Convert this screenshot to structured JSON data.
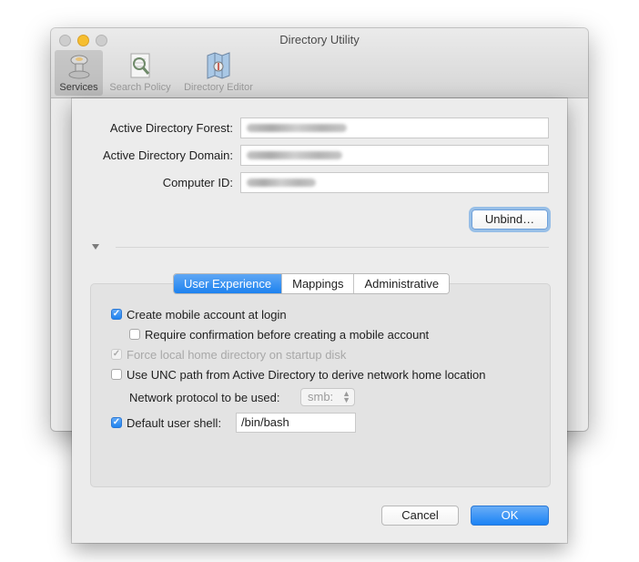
{
  "window": {
    "title": "Directory Utility",
    "toolbar": [
      {
        "label": "Services",
        "icon": "services-icon",
        "selected": true
      },
      {
        "label": "Search Policy",
        "icon": "search-policy-icon",
        "selected": false
      },
      {
        "label": "Directory Editor",
        "icon": "directory-editor-icon",
        "selected": false
      }
    ]
  },
  "sheet": {
    "fields": {
      "forest_label": "Active Directory Forest:",
      "domain_label": "Active Directory Domain:",
      "computer_id_label": "Computer ID:"
    },
    "unbind_button": "Unbind…",
    "tabs": [
      "User Experience",
      "Mappings",
      "Administrative"
    ],
    "active_tab": "User Experience",
    "options": {
      "create_mobile": {
        "label": "Create mobile account at login",
        "checked": true
      },
      "require_confirmation": {
        "label": "Require confirmation before creating a mobile account",
        "checked": false
      },
      "force_local_home": {
        "label": "Force local home directory on startup disk",
        "checked": true,
        "disabled": true
      },
      "use_unc_path": {
        "label": "Use UNC path from Active Directory to derive network home location",
        "checked": false
      }
    },
    "network_protocol": {
      "label": "Network protocol to be used:",
      "value": "smb:"
    },
    "default_shell": {
      "label": "Default user shell:",
      "checked": true,
      "value": "/bin/bash"
    },
    "cancel_button": "Cancel",
    "ok_button": "OK"
  },
  "colors": {
    "accent": "#1d82ef",
    "window_bg": "#ececec"
  }
}
